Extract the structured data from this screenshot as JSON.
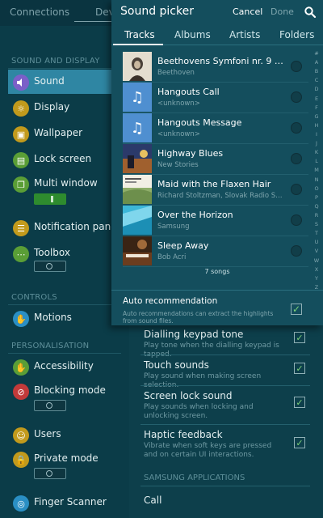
{
  "background_screen": {
    "top_tabs": [
      "Connections",
      "Devi"
    ],
    "left_sections": {
      "sound_and_display": "SOUND AND DISPLAY",
      "controls": "CONTROLS",
      "personalisation": "PERSONALISATION"
    },
    "left_items": [
      {
        "label": "Sound",
        "icon": "speaker-icon",
        "color": "#7b5fc8",
        "selected": true
      },
      {
        "label": "Display",
        "icon": "display-icon",
        "color": "#c29a1c"
      },
      {
        "label": "Wallpaper",
        "icon": "wallpaper-icon",
        "color": "#c29a1c"
      },
      {
        "label": "Lock screen",
        "icon": "lock-screen-icon",
        "color": "#5a9e36"
      },
      {
        "label": "Multi window",
        "icon": "multi-window-icon",
        "color": "#5a9e36",
        "toggle": "on"
      },
      {
        "label": "Notification panel",
        "icon": "notification-panel-icon",
        "color": "#c29a1c"
      },
      {
        "label": "Toolbox",
        "icon": "toolbox-icon",
        "color": "#5a9e36",
        "toggle": "off"
      },
      {
        "label": "Motions",
        "icon": "motions-icon",
        "color": "#2a8fc4"
      },
      {
        "label": "Accessibility",
        "icon": "accessibility-icon",
        "color": "#5a9e36"
      },
      {
        "label": "Blocking mode",
        "icon": "blocking-mode-icon",
        "color": "#c23a3a",
        "toggle": "off"
      },
      {
        "label": "Users",
        "icon": "users-icon",
        "color": "#c29a1c"
      },
      {
        "label": "Private mode",
        "icon": "private-mode-icon",
        "color": "#c29a1c",
        "toggle": "off"
      },
      {
        "label": "Finger Scanner",
        "icon": "finger-scanner-icon",
        "color": "#2a8fc4"
      }
    ],
    "right_settings": [
      {
        "title": "Dialling keypad tone",
        "desc": "Play tone when the dialling keypad is tapped.",
        "checked": true
      },
      {
        "title": "Touch sounds",
        "desc": "Play sound when making screen selection.",
        "checked": true
      },
      {
        "title": "Screen lock sound",
        "desc": "Play sounds when locking and unlocking screen.",
        "checked": true
      },
      {
        "title": "Haptic feedback",
        "desc": "Vibrate when soft keys are pressed and on certain UI interactions.",
        "checked": true
      }
    ],
    "samsung_apps_header": "SAMSUNG APPLICATIONS",
    "call_label": "Call"
  },
  "picker": {
    "title": "Sound picker",
    "cancel_label": "Cancel",
    "done_label": "Done",
    "tabs": [
      "Tracks",
      "Albums",
      "Artists",
      "Folders"
    ],
    "active_tab": "Tracks",
    "tracks": [
      {
        "title": "Beethovens Symfoni nr. 9 (Sch...",
        "subtitle": "Beethoven",
        "art": "portrait"
      },
      {
        "title": "Hangouts Call",
        "subtitle": "<unknown>",
        "art": "music-note-icon"
      },
      {
        "title": "Hangouts Message",
        "subtitle": "<unknown>",
        "art": "music-note-icon"
      },
      {
        "title": "Highway Blues",
        "subtitle": "New Stories",
        "art": "jazz-cover"
      },
      {
        "title": "Maid with the Flaxen Hair",
        "subtitle": "Richard Stoltzman, Slovak Radio Sym...",
        "art": "landscape-cover"
      },
      {
        "title": "Over the Horizon",
        "subtitle": "Samsung",
        "art": "samsung-cover"
      },
      {
        "title": "Sleep Away",
        "subtitle": "Bob Acri",
        "art": "piano-cover"
      }
    ],
    "song_count": "7 songs",
    "index_letters": [
      "#",
      "A",
      "B",
      "C",
      "D",
      "E",
      "F",
      "G",
      "H",
      "I",
      "J",
      "K",
      "L",
      "M",
      "N",
      "O",
      "P",
      "Q",
      "R",
      "S",
      "T",
      "U",
      "V",
      "W",
      "X",
      "Y",
      "Z"
    ],
    "auto_recommendation": {
      "title": "Auto recommendation",
      "desc": "Auto recommendations can extract the highlights from sound files.",
      "checked": true
    }
  },
  "colors": {
    "accent_selected": "#2f86a3",
    "check_green": "#7ed37a"
  }
}
